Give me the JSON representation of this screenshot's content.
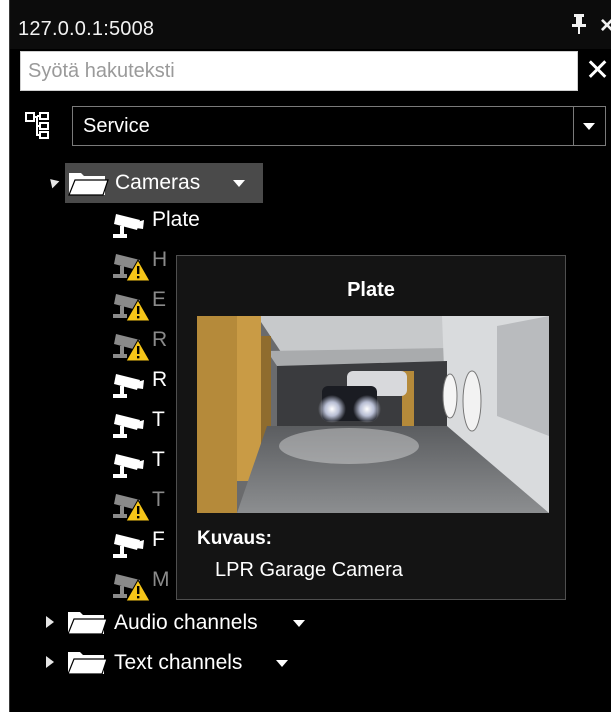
{
  "window": {
    "title": "127.0.0.1:5008"
  },
  "search": {
    "placeholder": "Syötä hakuteksti",
    "value": ""
  },
  "view_select": {
    "value": "Service"
  },
  "tree": {
    "cameras_folder": {
      "label": "Cameras"
    },
    "cameras": [
      {
        "label": "Plate",
        "status": "online"
      },
      {
        "label": "H",
        "status": "warning"
      },
      {
        "label": "E",
        "status": "warning"
      },
      {
        "label": "R",
        "status": "warning"
      },
      {
        "label": "R",
        "status": "online"
      },
      {
        "label": "T",
        "status": "online"
      },
      {
        "label": "T",
        "status": "online"
      },
      {
        "label": "T",
        "status": "warning"
      },
      {
        "label": "F",
        "status": "online"
      },
      {
        "label": "M",
        "status": "warning"
      }
    ],
    "audio_folder": {
      "label": "Audio channels"
    },
    "text_folder": {
      "label": "Text channels"
    }
  },
  "tooltip": {
    "title": "Plate",
    "description_label": "Kuvaus:",
    "description": "LPR Garage Camera"
  },
  "colors": {
    "background": "#000000",
    "selection": "#4a4a4a",
    "warning": "#f5c518",
    "text": "#ffffff",
    "offline_text": "#8a8a8a"
  },
  "icons": {
    "pin": "pin-icon",
    "close": "close-icon",
    "clear": "clear-search-icon",
    "hierarchy": "hierarchy-icon",
    "folder": "folder-icon",
    "camera": "camera-icon",
    "warning": "warning-icon"
  }
}
